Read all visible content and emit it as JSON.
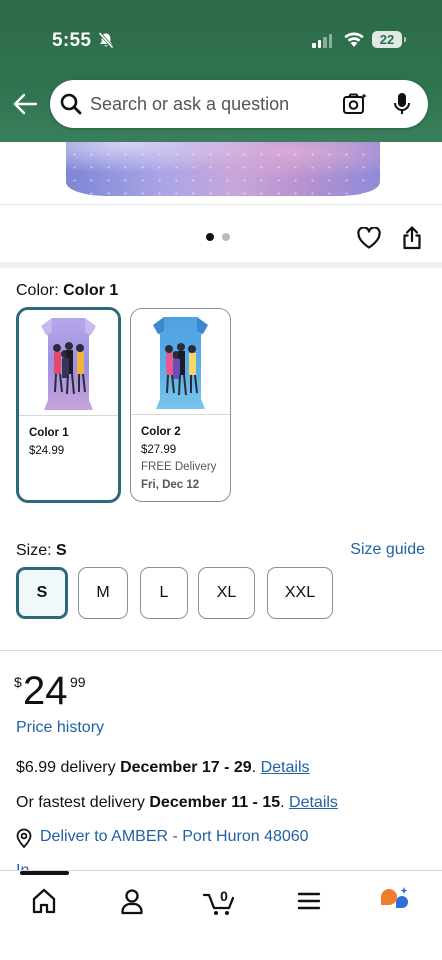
{
  "status_bar": {
    "time": "5:55",
    "battery": "22"
  },
  "search": {
    "placeholder": "Search or ask a question"
  },
  "color": {
    "label": "Color: ",
    "selected": "Color 1",
    "options": [
      {
        "name": "Color 1",
        "price": "$24.99"
      },
      {
        "name": "Color 2",
        "price": "$27.99",
        "delivery": "FREE Delivery",
        "date": "Fri, Dec 12"
      }
    ]
  },
  "size": {
    "label": "Size: ",
    "selected": "S",
    "guide": "Size guide",
    "options": [
      "S",
      "M",
      "L",
      "XL",
      "XXL"
    ]
  },
  "price": {
    "currency": "$",
    "whole": "24",
    "fraction": "99",
    "history_link": "Price history"
  },
  "delivery": {
    "standard_prefix": "$6.99 delivery ",
    "standard_dates": "December 17 - 29",
    "standard_suffix": ". ",
    "details_link": "Details",
    "fastest_prefix": "Or fastest delivery ",
    "fastest_dates": "December 11 - 15",
    "fastest_suffix": ". ",
    "location": "Deliver to AMBER - Port Huron 48060",
    "stock_peek": "In Stock"
  },
  "bottom_nav": {
    "cart_count": "0"
  },
  "colors": {
    "accent": "#2c6a7b",
    "link": "#2162a1",
    "header": "#2f7250"
  }
}
